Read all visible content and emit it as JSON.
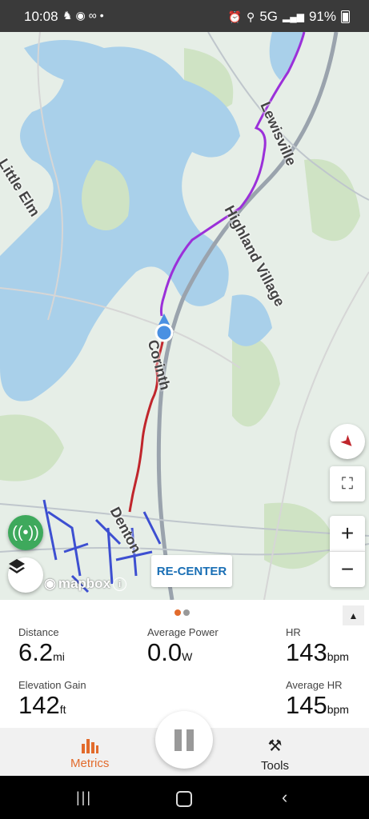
{
  "status_bar": {
    "time": "10:08",
    "network": "5G",
    "battery": "91%"
  },
  "map": {
    "labels": {
      "lewisville": "Lewisville",
      "highland_village": "Highland Village",
      "little_elm": "Little Elm",
      "corinth": "Corinth",
      "denton": "Denton"
    },
    "route_colors": {
      "completed": "#c0262c",
      "remaining": "#9b30d9",
      "position": "#4a90e2"
    },
    "recenter_label": "RE-CENTER",
    "attribution": "mapbox",
    "zoom_in": "+",
    "zoom_out": "−"
  },
  "panel": {
    "page_dots": {
      "active_color": "#e26b2c",
      "inactive_color": "#999999"
    },
    "metrics": {
      "distance": {
        "label": "Distance",
        "value": "6.2",
        "unit": "mi"
      },
      "avg_power": {
        "label": "Average Power",
        "value": "0.0",
        "unit": "W"
      },
      "hr": {
        "label": "HR",
        "value": "143",
        "unit": "bpm"
      },
      "elevation": {
        "label": "Elevation Gain",
        "value": "142",
        "unit": "ft"
      },
      "avg_hr": {
        "label": "Average HR",
        "value": "145",
        "unit": "bpm"
      }
    }
  },
  "bottom_nav": {
    "metrics_label": "Metrics",
    "tools_label": "Tools",
    "accent": "#e26b2c"
  }
}
